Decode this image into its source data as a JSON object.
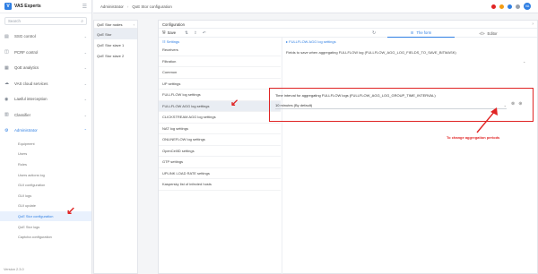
{
  "app": {
    "name": "VAS Experts",
    "version": "Version 2.3.0"
  },
  "search": {
    "placeholder": "Search"
  },
  "sidebar": {
    "items": [
      {
        "label": "SSG control",
        "icon": "server-icon"
      },
      {
        "label": "PCRF control",
        "icon": "layers-icon"
      },
      {
        "label": "QoE analytics",
        "icon": "chart-icon"
      },
      {
        "label": "VAS cloud services",
        "icon": "cloud-icon"
      },
      {
        "label": "Lawful interception",
        "icon": "eye-icon"
      },
      {
        "label": "Classifier",
        "icon": "bars-icon"
      },
      {
        "label": "Administrator",
        "icon": "gear-icon"
      }
    ],
    "sub_items": [
      "Equipment",
      "Users",
      "Roles",
      "Users actions log",
      "GUI configuration",
      "GUI logs",
      "GUI update",
      "QoE Stor configuration",
      "QoE Stor logs",
      "Captcha configuration"
    ],
    "active_sub": "QoE Stor configuration"
  },
  "breadcrumb": {
    "root": "Administrator",
    "current": "QoE Stor configuration"
  },
  "topbar": {
    "avatar": "VA",
    "colors": {
      "red": "#e02424",
      "orange": "#f39c12",
      "blue": "#2f7fe3"
    }
  },
  "nodes": {
    "title": "QoE Stor nodes",
    "items": [
      "QoE Stor",
      "QoE Stor slave 1",
      "QoE Stor slave 2"
    ],
    "active": "QoE Stor"
  },
  "config": {
    "title": "Configuration",
    "save_label": "Save",
    "tabs": [
      {
        "label": "The form",
        "active": true
      },
      {
        "label": "Editor",
        "active": false
      }
    ],
    "settings_title": "Settings",
    "settings": [
      "Receivers",
      "Filtration",
      "Common",
      "UP settings",
      "FULLFLOW log settings",
      "FULLFLOW AGG log settings",
      "CLICKSTREAM AGG log settings",
      "NAT log settings",
      "ONLINEFLOW log settings",
      "OpenCellID settings",
      "GTP settings",
      "UPLINK LOAD RATE settings",
      "Kaspersky list of infected hosts"
    ],
    "active_setting": "FULLFLOW AGG log settings",
    "detail_title": "FULLFLOW AGG log settings",
    "field1_label": "Fields to save when aggregating FULLFLOW log (FULLFLOW_AGG_LOG_FIELDS_TO_SAVE_BITMASK)",
    "field2_label": "Time interval for aggregating FULLFLOW logs (FULLFLOW_AGG_LOG_GROUP_TIME_INTERVAL)",
    "field2_value": "10 minutes (By default)"
  },
  "annotation": "To change aggregation periods",
  "accent": "#2f7fe3",
  "highlight": "#e02424"
}
